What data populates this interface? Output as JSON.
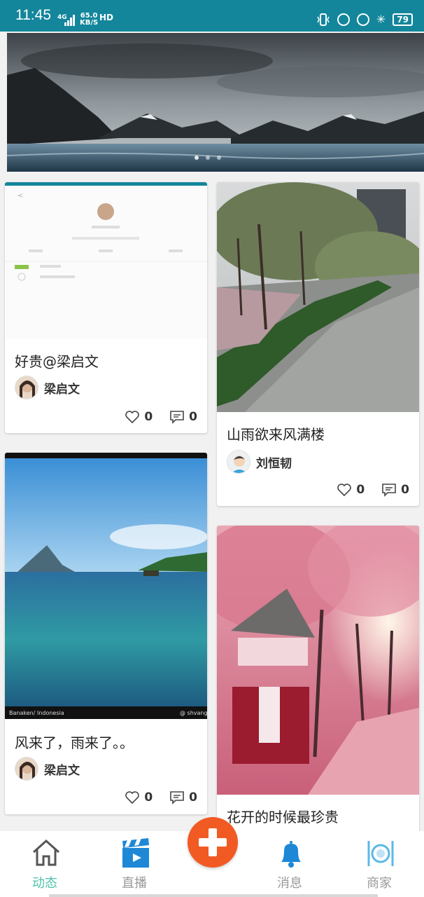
{
  "status_bar": {
    "time": "11:45",
    "network": "4G",
    "speed_value": "65.0",
    "speed_unit": "KB/S",
    "hd": "HD",
    "battery": "79"
  },
  "banner": {
    "image": "mountain-lake-landscape",
    "page_count": 3,
    "active_page": 1
  },
  "posts": [
    {
      "title": "好贵@梁启文",
      "author": "梁启文",
      "likes": "0",
      "comments": "0",
      "image": "profile-screenshot"
    },
    {
      "title": "山雨欲来风满楼",
      "author": "刘恒韧",
      "likes": "0",
      "comments": "0",
      "image": "rainy-street-trees"
    },
    {
      "title": "风来了，雨来了。。",
      "author": "梁启文",
      "likes": "0",
      "comments": "0",
      "image": "tropical-sea-island",
      "image_caption_left": "Banaken/ Indonesia",
      "image_caption_right": "@ shvang"
    },
    {
      "title": "花开的时候最珍贵",
      "image": "cherry-blossom-cabin"
    }
  ],
  "bottom_nav": [
    {
      "label": "动态",
      "icon": "home-icon",
      "active": true
    },
    {
      "label": "直播",
      "icon": "video-clapper-icon",
      "active": false
    },
    {
      "label": "",
      "icon": "plus-icon",
      "active": false
    },
    {
      "label": "消息",
      "icon": "bell-icon",
      "active": false
    },
    {
      "label": "商家",
      "icon": "dining-icon",
      "active": false
    }
  ],
  "colors": {
    "status_bar": "#13869b",
    "accent_active": "#4fc3a9",
    "fab": "#f15a22",
    "nav_inactive": "#999999"
  }
}
